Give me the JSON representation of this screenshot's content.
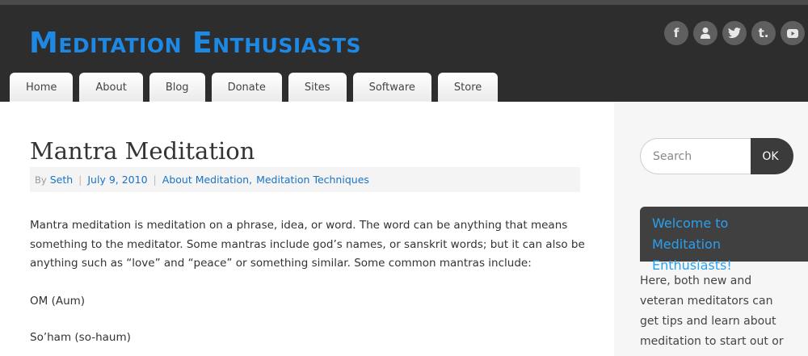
{
  "site": {
    "title": "Meditation Enthusiasts"
  },
  "social": [
    {
      "icon": "facebook-icon",
      "glyph": "f"
    },
    {
      "icon": "user-icon",
      "glyph": ""
    },
    {
      "icon": "twitter-icon",
      "glyph": ""
    },
    {
      "icon": "tumblr-icon",
      "glyph": "t."
    },
    {
      "icon": "youtube-icon",
      "glyph": ""
    }
  ],
  "nav": {
    "items": [
      "Home",
      "About",
      "Blog",
      "Donate",
      "Sites",
      "Software",
      "Store"
    ]
  },
  "post": {
    "title": "Mantra Meditation",
    "meta": {
      "by_label": "By",
      "author": "Seth",
      "separator": "|",
      "date": "July 9, 2010",
      "category1": "About Meditation",
      "comma": ",",
      "category2": "Meditation Techniques"
    },
    "paragraphs": [
      "Mantra meditation is meditation on a phrase, idea, or word. The word can be anything that means something to the meditator. Some mantras include god’s names, or sanskrit words; but it can also be anything such as “love” and “peace” or something similar. Some common mantras include:",
      "OM (Aum)",
      "So’ham (so-haum)"
    ]
  },
  "sidebar": {
    "search": {
      "placeholder": "Search",
      "button_label": "OK"
    },
    "widget": {
      "title": "Welcome to Meditation Enthusiasts!",
      "text": "Here, both new and veteran meditators can get tips and learn about meditation to start out or improve their"
    }
  },
  "colors": {
    "header_bg": "#2d2d2d",
    "title_blue": "#1e88e5",
    "link_blue": "#1a73c4",
    "widget_bg": "#404040",
    "widget_title": "#2aa0f0"
  }
}
